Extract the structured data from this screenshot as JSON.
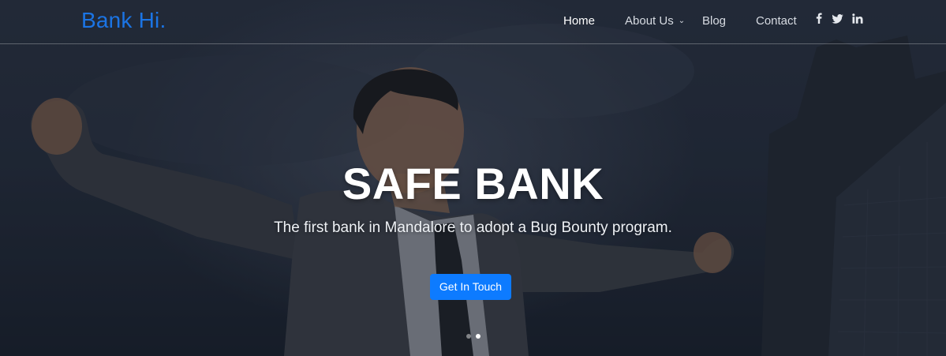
{
  "brand": {
    "name": "Bank Hi."
  },
  "nav": {
    "items": [
      {
        "label": "Home",
        "active": true
      },
      {
        "label": "About Us",
        "dropdown": true
      },
      {
        "label": "Blog"
      },
      {
        "label": "Contact"
      }
    ],
    "social": [
      {
        "icon": "facebook-icon",
        "glyph": "f"
      },
      {
        "icon": "twitter-icon",
        "glyph": ""
      },
      {
        "icon": "linkedin-icon",
        "glyph": "in"
      }
    ]
  },
  "hero": {
    "title": "SAFE BANK",
    "subtitle": "The first bank in Mandalore to adopt a Bug Bounty program.",
    "cta_label": "Get In Touch",
    "slides": {
      "count": 2,
      "active_index": 1
    }
  },
  "colors": {
    "brand": "#1b74e4",
    "cta": "#0d7bff",
    "text": "#ffffff"
  }
}
